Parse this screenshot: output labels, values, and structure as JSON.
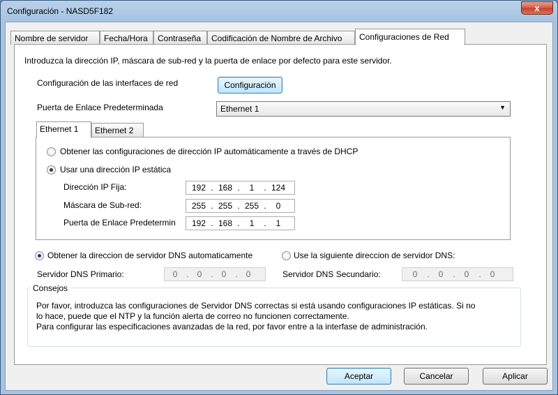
{
  "window": {
    "title": "Configuración - NASD5F182",
    "close_label": "x"
  },
  "tabs": [
    "Nombre de servidor",
    "Fecha/Hora",
    "Contraseña",
    "Codificación de Nombre de Archivo",
    "Configuraciones de Red"
  ],
  "intro": "Introduzca la dirección IP, máscara de sub-red y la puerta de enlace por defecto para este servidor.",
  "interfaces": {
    "label": "Configuración de las interfaces de red",
    "button": "Configuración"
  },
  "gateway": {
    "label": "Puerta de Enlace Predeterminada",
    "selected": "Ethernet 1",
    "arrow": "▼"
  },
  "inner_tabs": [
    "Ethernet 1",
    "Ethernet 2"
  ],
  "ip": {
    "dhcp_label": "Obtener las configuraciones de dirección IP automáticamente a través de DHCP",
    "static_label": "Usar una dirección IP estática",
    "fixed_ip_label": "Dirección IP Fija:",
    "fixed_ip": [
      "192",
      "168",
      "1",
      "124"
    ],
    "mask_label": "Máscara de Sub-red:",
    "mask": [
      "255",
      "255",
      "255",
      "0"
    ],
    "gw_label": "Puerta de Enlace Predetermin",
    "gw": [
      "192",
      "168",
      "1",
      "1"
    ]
  },
  "dns": {
    "auto_label": "Obtener la direccion de servidor DNS automaticamente",
    "manual_label": "Use la siguiente direccion de servidor DNS:",
    "primary_label": "Servidor DNS Primario:",
    "primary": [
      "0",
      "0",
      "0",
      "0"
    ],
    "secondary_label": "Servidor DNS Secundario:",
    "secondary": [
      "0",
      "0",
      "0",
      "0"
    ]
  },
  "tips": {
    "title": "Consejos",
    "line1": "Por favor, introduzca las configuraciones de Servidor DNS correctas si está usando configuraciones IP estáticas.  Si no",
    "line2": "lo hace, puede que el NTP y la función alerta de correo no funcionen correctamente.",
    "line3": "Para configurar las especificaciones avanzadas de la red, por favor entre a la interfase de administración."
  },
  "buttons": {
    "ok": "Aceptar",
    "cancel": "Cancelar",
    "apply": "Aplicar"
  }
}
